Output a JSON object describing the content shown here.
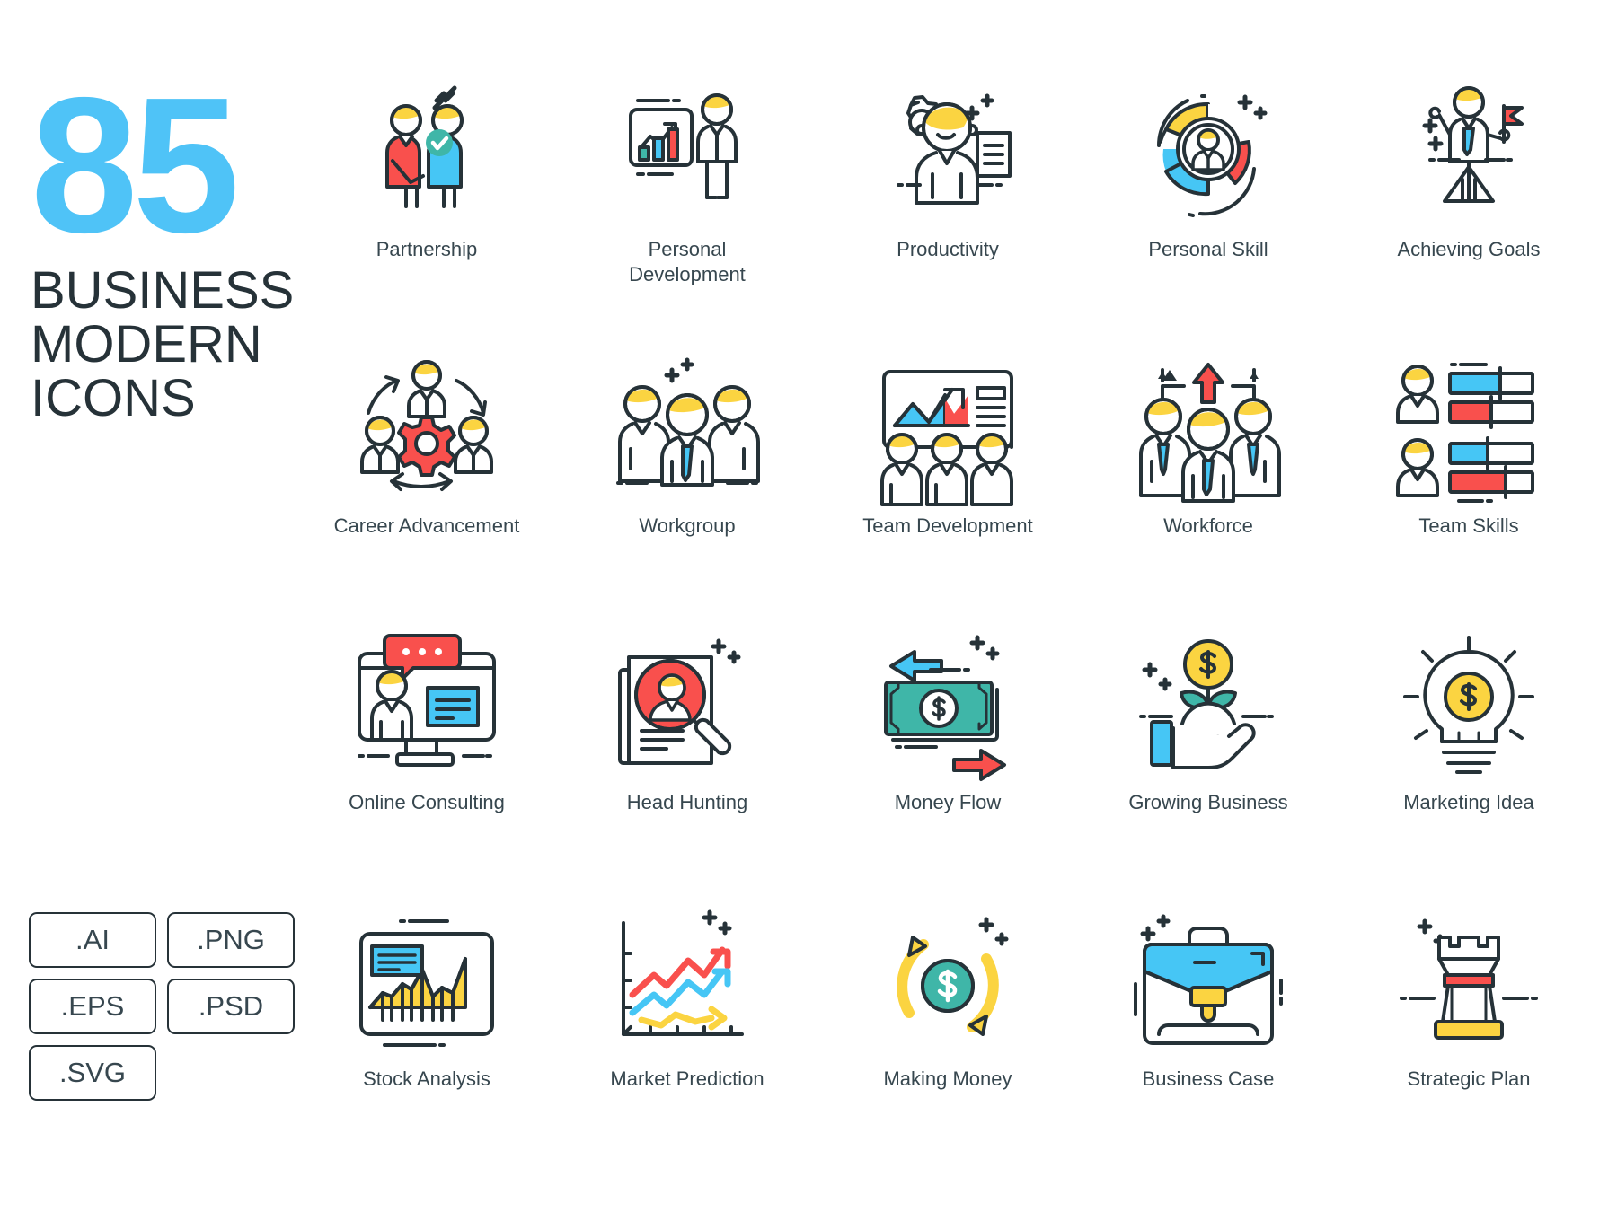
{
  "title": {
    "number": "85",
    "line1": "Business",
    "line2": "Modern",
    "line3": "Icons"
  },
  "colors": {
    "accent_blue": "#4FC3F7",
    "outline": "#263238",
    "red": "#F9504D",
    "yellow": "#FBD441",
    "teal": "#3FB6A8",
    "light_blue": "#46C6F5",
    "text": "#37474F"
  },
  "formats": [
    {
      "label": ".AI"
    },
    {
      "label": ".PNG"
    },
    {
      "label": ".EPS"
    },
    {
      "label": ".PSD"
    },
    {
      "label": ".SVG"
    }
  ],
  "icons": [
    {
      "label": "Partnership",
      "icon": "handshake-partnership-icon"
    },
    {
      "label": "Personal\nDevelopment",
      "icon": "presentation-bars-person-icon"
    },
    {
      "label": "Productivity",
      "icon": "person-gear-document-icon"
    },
    {
      "label": "Personal Skill",
      "icon": "donut-chart-avatar-icon"
    },
    {
      "label": "Achieving Goals",
      "icon": "person-mountain-flag-icon"
    },
    {
      "label": "Career Advancement",
      "icon": "three-people-gear-cycle-icon"
    },
    {
      "label": "Workgroup",
      "icon": "three-people-tie-icon"
    },
    {
      "label": "Team Development",
      "icon": "board-area-chart-team-icon"
    },
    {
      "label": "Workforce",
      "icon": "team-up-arrow-icon"
    },
    {
      "label": "Team Skills",
      "icon": "avatars-progress-bars-icon"
    },
    {
      "label": "Online Consulting",
      "icon": "monitor-chat-person-icon"
    },
    {
      "label": "Head Hunting",
      "icon": "documents-magnifier-person-icon"
    },
    {
      "label": "Money Flow",
      "icon": "banknote-arrows-icon"
    },
    {
      "label": "Growing Business",
      "icon": "hand-plant-coin-icon"
    },
    {
      "label": "Marketing Idea",
      "icon": "lightbulb-dollar-icon"
    },
    {
      "label": "Stock Analysis",
      "icon": "screen-area-chart-icon"
    },
    {
      "label": "Market Prediction",
      "icon": "zigzag-arrows-graph-icon"
    },
    {
      "label": "Making Money",
      "icon": "circular-arrows-dollar-icon"
    },
    {
      "label": "Business Case",
      "icon": "briefcase-icon"
    },
    {
      "label": "Strategic Plan",
      "icon": "chess-rook-icon"
    }
  ]
}
